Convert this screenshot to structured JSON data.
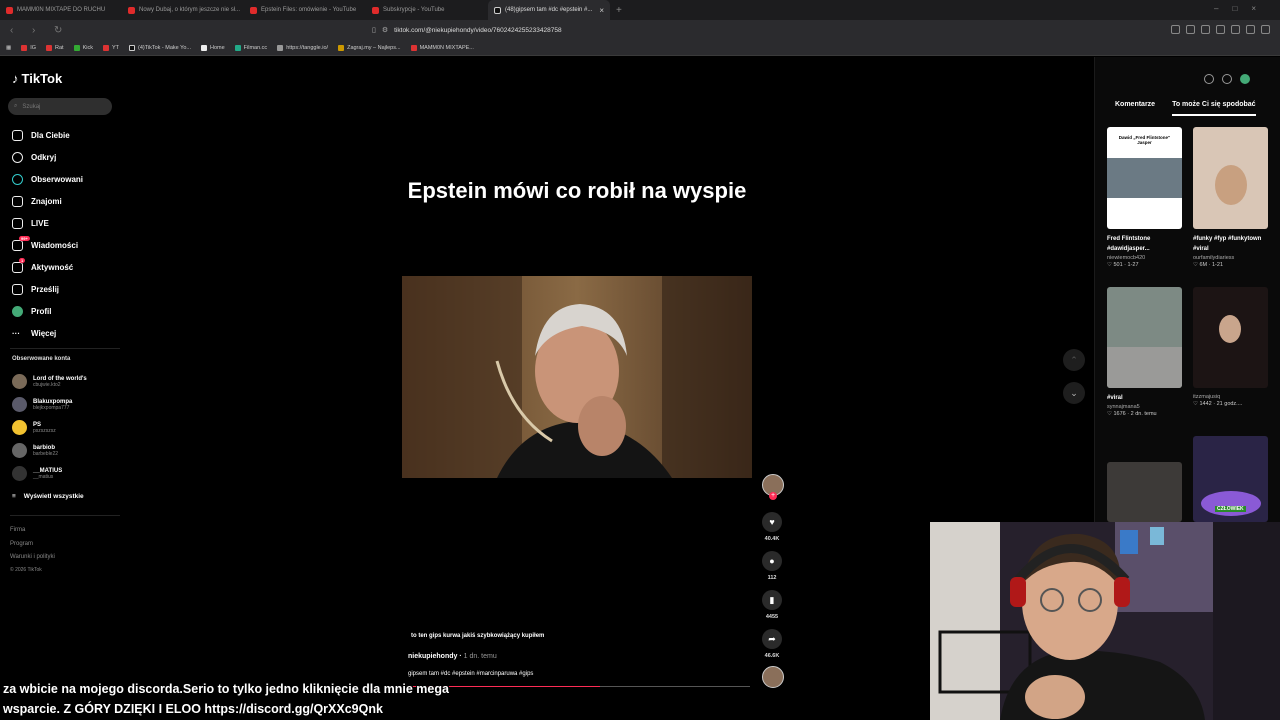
{
  "browser": {
    "tabs": [
      {
        "title": "MAMM0N MIXTAPE DO RUCHU"
      },
      {
        "title": "Nowy Dubaj, o którym jeszcze nie sł..."
      },
      {
        "title": "Epstein Files: omówienie - YouTube"
      },
      {
        "title": "Subskrypcje - YouTube"
      },
      {
        "title": "(48)gipsem tam #dc #epstein #..."
      }
    ],
    "url": "tiktok.com/@niekupiehondy/video/7602424255233428758",
    "bookmarks": [
      "IG",
      "Rat",
      "Kick",
      "YT",
      "(4)TikTok - Make Yo...",
      "Home",
      "Filman.cc",
      "https://tanggle.io/",
      "Zagraj.my – Najleps...",
      "MAMM0N MIXTAPE..."
    ]
  },
  "tiktok": {
    "logo": "TikTok",
    "search_placeholder": "Szukaj",
    "menu": [
      {
        "label": "Dla Ciebie",
        "icon": "home-icon"
      },
      {
        "label": "Odkryj",
        "icon": "compass-icon"
      },
      {
        "label": "Obserwowani",
        "icon": "following-icon"
      },
      {
        "label": "Znajomi",
        "icon": "friends-icon"
      },
      {
        "label": "LIVE",
        "icon": "live-icon"
      },
      {
        "label": "Wiadomości",
        "icon": "messages-icon",
        "badge": "99+"
      },
      {
        "label": "Aktywność",
        "icon": "activity-icon",
        "badge": "1"
      },
      {
        "label": "Prześlij",
        "icon": "upload-icon"
      },
      {
        "label": "Profil",
        "icon": "profile-icon"
      },
      {
        "label": "Więcej",
        "icon": "more-icon"
      }
    ],
    "following_header": "Obserwowane konta",
    "accounts": [
      {
        "name": "Lord of the world's",
        "handle": "cbujwie.kto2"
      },
      {
        "name": "Blakuxpompa",
        "handle": "blejkxpompa777"
      },
      {
        "name": "PS",
        "handle": "pszszszsz"
      },
      {
        "name": "barbiob",
        "handle": "barbeble22"
      },
      {
        "name": "__MATIUS",
        "handle": "__matius"
      }
    ],
    "show_all": "Wyświetl wszystkie",
    "footer": [
      "Firma",
      "Program",
      "Warunki i polityki",
      "© 2026 TikTok"
    ]
  },
  "video": {
    "title": "Epstein mówi co robił na wyspie",
    "caption_overlay": "to ten gips kurwa jakiś szybkowiążący kupiłem",
    "author": "niekupiehondy",
    "date": "1 dn. temu",
    "tags": "gipsem tam #dc #epstein #marcinparuwa #gips",
    "progress": 0.56,
    "likes": "40.4K",
    "comments": "112",
    "saves": "4455",
    "shares": "46.6K"
  },
  "right_panel": {
    "tabs": [
      "Komentarze",
      "To może Ci się spodobać"
    ],
    "thumb_overlay_text": "Dawid „Fred Flintstone\" Jasper",
    "items": [
      {
        "title": "Fred Flintstone #dawidjasper...",
        "author": "niewiemocb420",
        "likes": "501",
        "date": "1-27"
      },
      {
        "title": "#funky #fyp #funkytown #viral",
        "author": "ourfamilydiariess",
        "likes": "6M",
        "date": "1-21"
      },
      {
        "title": "#viral",
        "author": "synnajmana5",
        "likes": "1676",
        "date": "2 dn. temu"
      },
      {
        "title": "",
        "author": "itzzmajusiq",
        "likes": "1442",
        "date": "21 godz...."
      }
    ],
    "sticker": "CZŁOWIEK"
  },
  "ticker": "za wbicie na mojego discorda.Serio to tylko jedno kliknięcie dla mnie mega wsparcie. Z GÓRY DZIĘKI I ELOO https://discord.gg/QrXXc9Qnk"
}
